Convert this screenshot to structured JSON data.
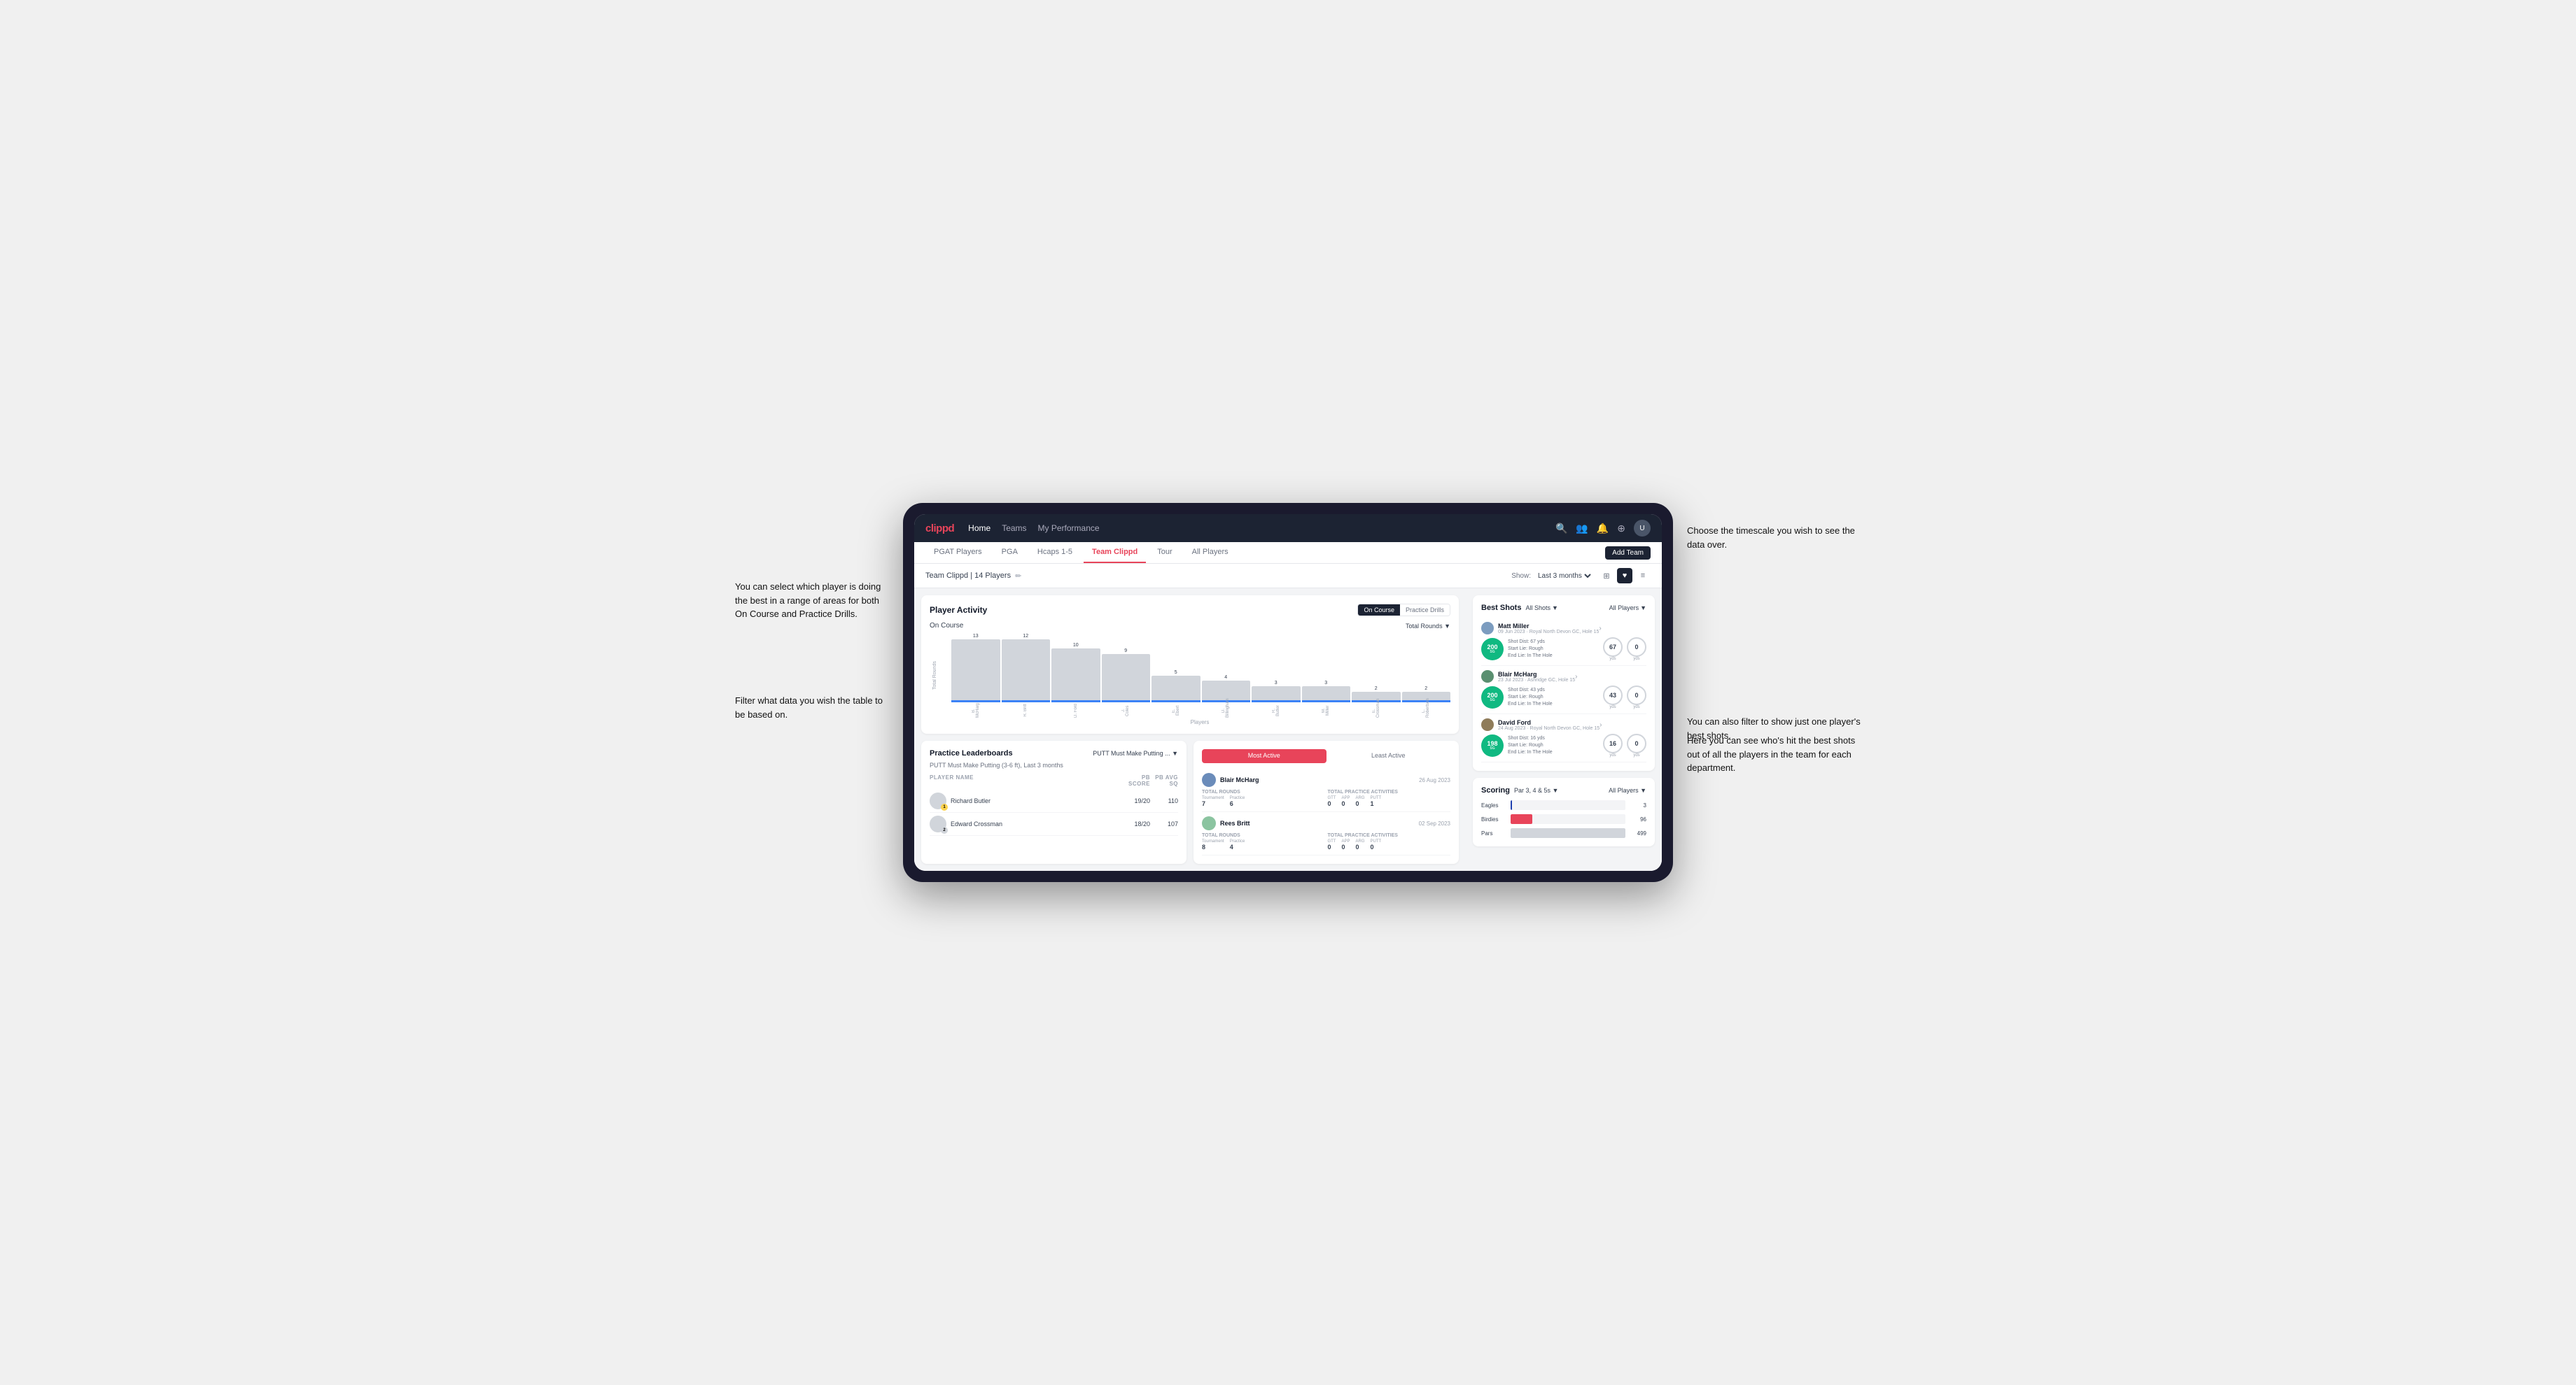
{
  "annotations": {
    "top_left": "You can select which player is doing the best in a range of areas for both On Course and Practice Drills.",
    "bottom_left": "Filter what data you wish the table to be based on.",
    "top_right": "Choose the timescale you wish to see the data over.",
    "mid_right": "Here you can see who's hit the best shots out of all the players in the team for each department.",
    "bottom_right": "You can also filter to show just one player's best shots."
  },
  "nav": {
    "logo": "clippd",
    "links": [
      "Home",
      "Teams",
      "My Performance"
    ],
    "icons": [
      "search",
      "people",
      "bell",
      "plus",
      "avatar"
    ]
  },
  "tabs": {
    "items": [
      "PGAT Players",
      "PGA",
      "Hcaps 1-5",
      "Team Clippd",
      "Tour",
      "All Players"
    ],
    "active": "Team Clippd",
    "add_button": "Add Team"
  },
  "sub_header": {
    "team_name": "Team Clippd | 14 Players",
    "show_label": "Show:",
    "time_period": "Last 3 months",
    "view_options": [
      "grid",
      "list",
      "heart",
      "settings"
    ]
  },
  "player_activity": {
    "title": "Player Activity",
    "toggle": [
      "On Course",
      "Practice Drills"
    ],
    "active_toggle": "On Course",
    "chart": {
      "sub_title": "On Course",
      "filter": "Total Rounds",
      "y_labels": [
        "0",
        "5",
        "10",
        "15"
      ],
      "bars": [
        {
          "name": "B. McHarg",
          "value": 13,
          "pct": 87
        },
        {
          "name": "R. Britt",
          "value": 12,
          "pct": 80
        },
        {
          "name": "D. Ford",
          "value": 10,
          "pct": 67
        },
        {
          "name": "J. Coles",
          "value": 9,
          "pct": 60
        },
        {
          "name": "E. Ebert",
          "value": 5,
          "pct": 33
        },
        {
          "name": "D. Billingham",
          "value": 4,
          "pct": 27
        },
        {
          "name": "R. Butler",
          "value": 3,
          "pct": 20
        },
        {
          "name": "M. Miller",
          "value": 3,
          "pct": 20
        },
        {
          "name": "E. Crossman",
          "value": 2,
          "pct": 13
        },
        {
          "name": "L. Robertson",
          "value": 2,
          "pct": 13
        }
      ]
    },
    "x_label": "Players"
  },
  "practice_leaderboards": {
    "title": "Practice Leaderboards",
    "filter": "PUTT Must Make Putting ...",
    "sub": "PUTT Must Make Putting (3-6 ft), Last 3 months",
    "columns": [
      "PLAYER NAME",
      "PB SCORE",
      "PB AVG SQ"
    ],
    "rows": [
      {
        "name": "Richard Butler",
        "pb_score": "19/20",
        "pb_avg": "110",
        "rank": 1
      },
      {
        "name": "Edward Crossman",
        "pb_score": "18/20",
        "pb_avg": "107",
        "rank": 2
      }
    ]
  },
  "most_active": {
    "title": "",
    "tabs": [
      "Most Active",
      "Least Active"
    ],
    "active_tab": "Most Active",
    "players": [
      {
        "name": "Blair McHarg",
        "date": "26 Aug 2023",
        "total_rounds_label": "Total Rounds",
        "tournament": "7",
        "practice": "6",
        "practice_activities_label": "Total Practice Activities",
        "gtt": "0",
        "app": "0",
        "arg": "0",
        "putt": "1"
      },
      {
        "name": "Rees Britt",
        "date": "02 Sep 2023",
        "total_rounds_label": "Total Rounds",
        "tournament": "8",
        "practice": "4",
        "practice_activities_label": "Total Practice Activities",
        "gtt": "0",
        "app": "0",
        "arg": "0",
        "putt": "0"
      }
    ]
  },
  "best_shots": {
    "title": "Best Shots",
    "filter": "All Shots",
    "players_filter": "All Players",
    "shots": [
      {
        "player": "Matt Miller",
        "date": "09 Jun 2023",
        "course": "Royal North Devon GC",
        "hole": "Hole 15",
        "badge_num": "200",
        "badge_label": "SG",
        "shot_dist": "Shot Dist: 67 yds",
        "start_lie": "Start Lie: Rough",
        "end_lie": "End Lie: In The Hole",
        "metric1": "67",
        "metric1_label": "yds",
        "metric2": "0",
        "metric2_label": "yds"
      },
      {
        "player": "Blair McHarg",
        "date": "23 Jul 2023",
        "course": "Ashridge GC",
        "hole": "Hole 15",
        "badge_num": "200",
        "badge_label": "SG",
        "shot_dist": "Shot Dist: 43 yds",
        "start_lie": "Start Lie: Rough",
        "end_lie": "End Lie: In The Hole",
        "metric1": "43",
        "metric1_label": "yds",
        "metric2": "0",
        "metric2_label": "yds"
      },
      {
        "player": "David Ford",
        "date": "24 Aug 2023",
        "course": "Royal North Devon GC",
        "hole": "Hole 15",
        "badge_num": "198",
        "badge_label": "SG",
        "shot_dist": "Shot Dist: 16 yds",
        "start_lie": "Start Lie: Rough",
        "end_lie": "End Lie: In The Hole",
        "metric1": "16",
        "metric1_label": "yds",
        "metric2": "0",
        "metric2_label": "yds"
      }
    ]
  },
  "scoring": {
    "title": "Scoring",
    "filter": "Par 3, 4 & 5s",
    "players_filter": "All Players",
    "rows": [
      {
        "label": "Eagles",
        "value": 3,
        "max": 500,
        "color": "eagles"
      },
      {
        "label": "Birdies",
        "value": 96,
        "max": 500,
        "color": "birdies"
      },
      {
        "label": "Pars",
        "value": 499,
        "max": 500,
        "color": "pars"
      }
    ]
  }
}
